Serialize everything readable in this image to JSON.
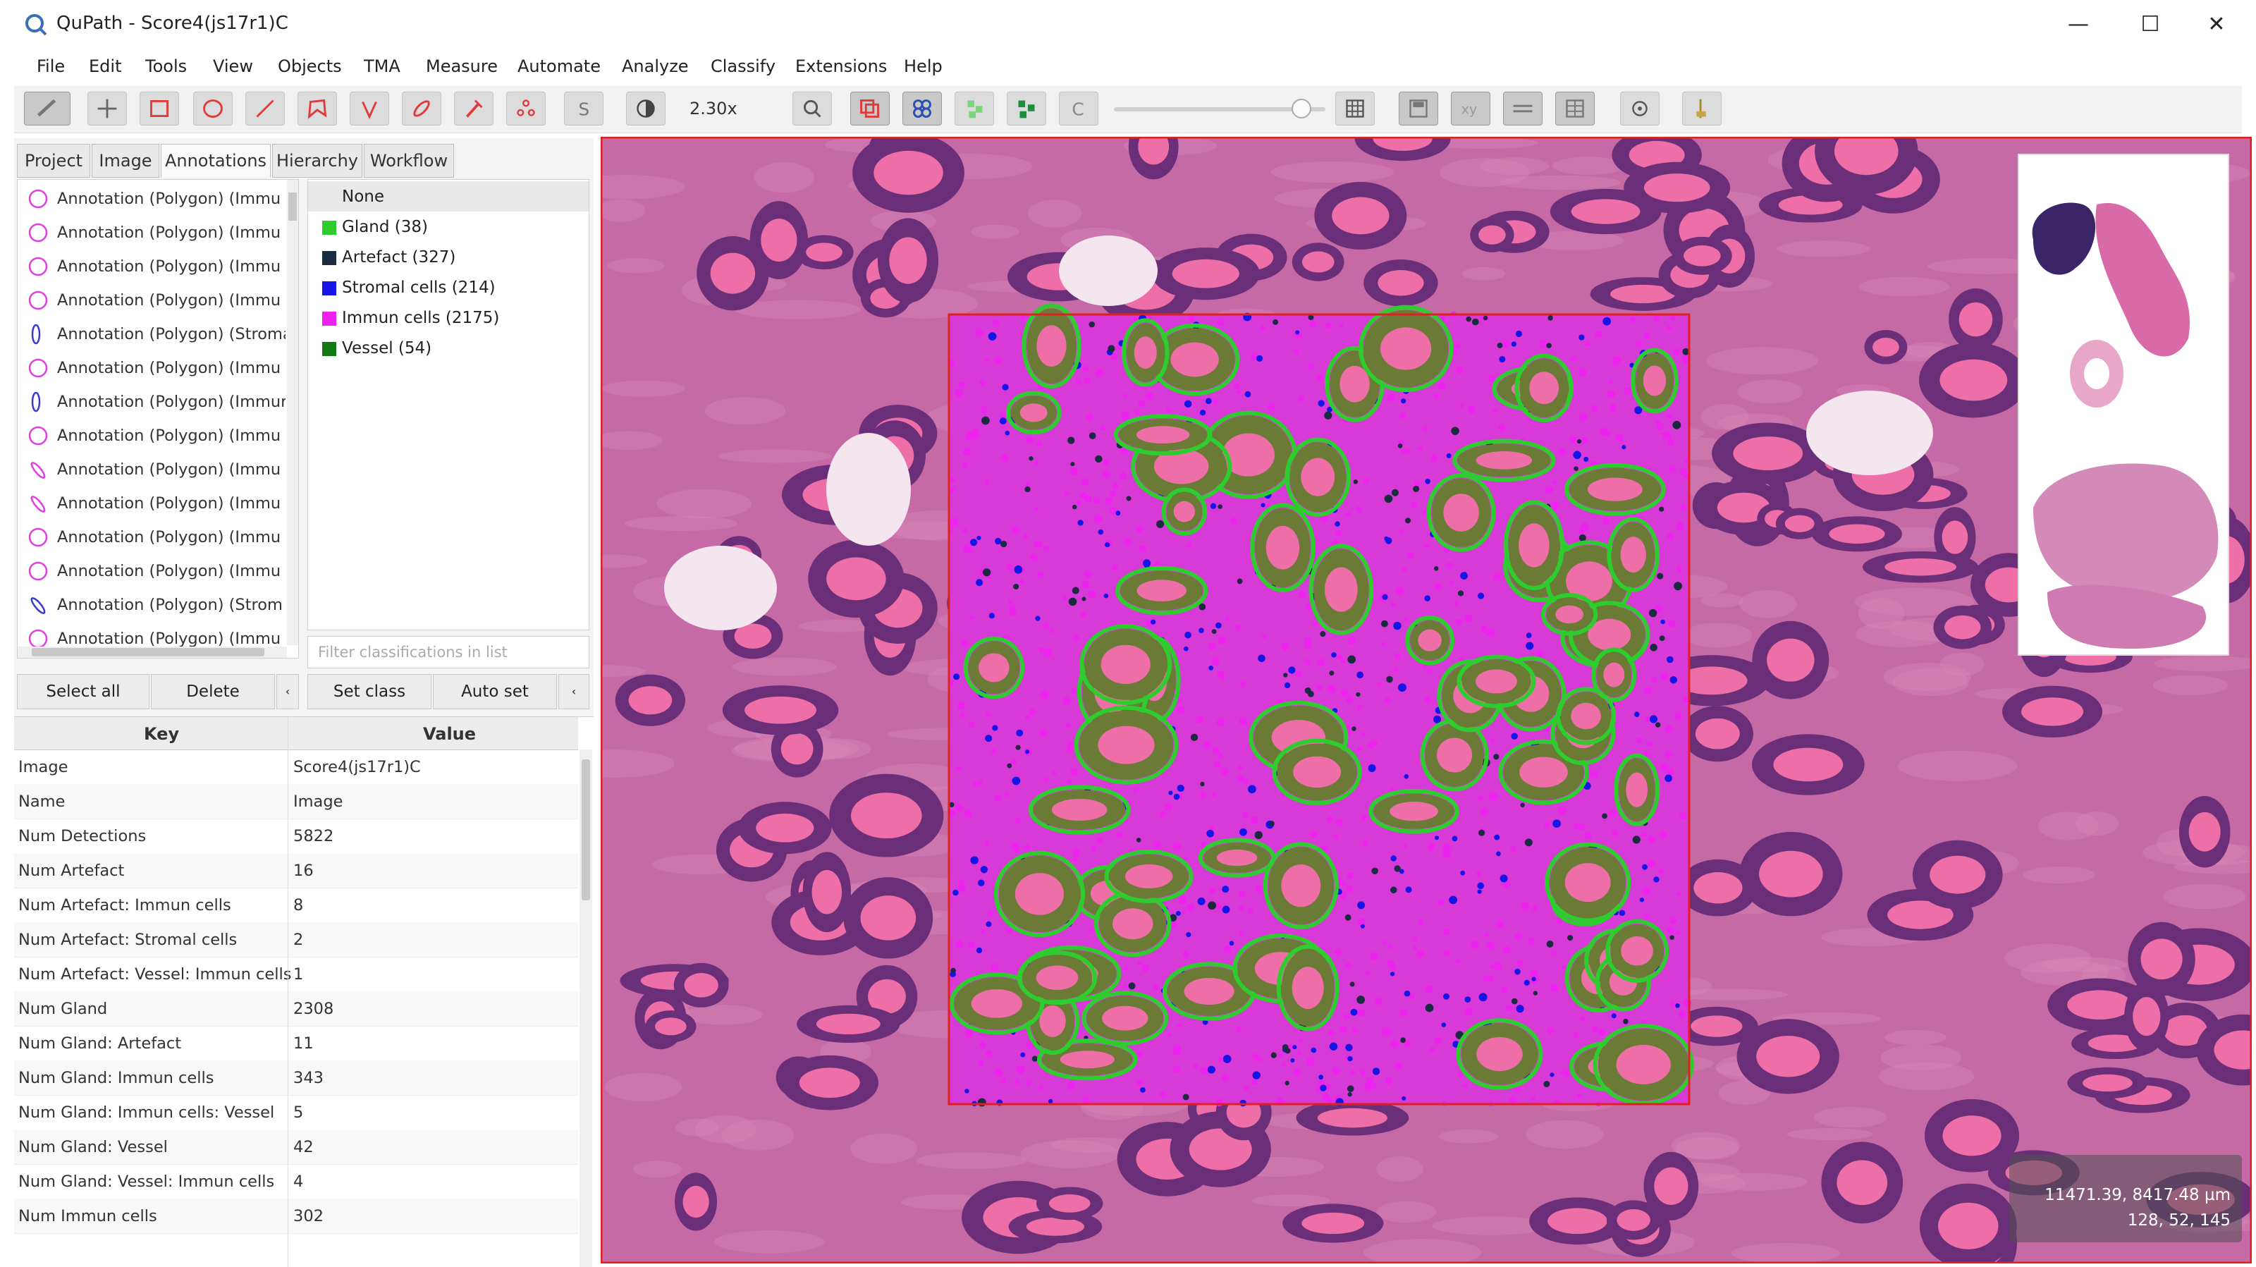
{
  "window": {
    "title": "QuPath - Score4(js17r1)C",
    "controls": {
      "minimize": "—",
      "maximize": "☐",
      "close": "✕"
    }
  },
  "menu": [
    "File",
    "Edit",
    "Tools",
    "View",
    "Objects",
    "TMA",
    "Measure",
    "Automate",
    "Analyze",
    "Classify",
    "Extensions",
    "Help"
  ],
  "toolbar": {
    "zoom_label": "2.30x",
    "tools": [
      "move-tool-icon",
      "rectangle-tool-icon",
      "ellipse-tool-icon",
      "line-tool-icon",
      "polygon-tool-icon",
      "polyline-tool-icon",
      "brush-tool-icon",
      "wand-tool-icon",
      "points-tool-icon"
    ],
    "colors": {
      "red_icon": "#e23a3a",
      "selected_bg": "#c9c9c9"
    }
  },
  "tabs": [
    "Project",
    "Image",
    "Annotations",
    "Hierarchy",
    "Workflow"
  ],
  "active_tab": "Annotations",
  "annotations": [
    {
      "label": "Annotation (Polygon) (Immu",
      "shape": "circle"
    },
    {
      "label": "Annotation (Polygon) (Immu",
      "shape": "circle"
    },
    {
      "label": "Annotation (Polygon) (Immu",
      "shape": "circle"
    },
    {
      "label": "Annotation (Polygon) (Immu",
      "shape": "circle"
    },
    {
      "label": "Annotation (Polygon) (Stroma",
      "shape": "narrow"
    },
    {
      "label": "Annotation (Polygon) (Immu",
      "shape": "circle"
    },
    {
      "label": "Annotation (Polygon) (Immun",
      "shape": "narrow"
    },
    {
      "label": "Annotation (Polygon) (Immu",
      "shape": "circle"
    },
    {
      "label": "Annotation (Polygon) (Immu",
      "shape": "slash"
    },
    {
      "label": "Annotation (Polygon) (Immu",
      "shape": "slash"
    },
    {
      "label": "Annotation (Polygon) (Immu",
      "shape": "circle"
    },
    {
      "label": "Annotation (Polygon) (Immu",
      "shape": "circle"
    },
    {
      "label": "Annotation (Polygon) (Strom",
      "shape": "slash-blue"
    },
    {
      "label": "Annotation (Polygon) (Immu",
      "shape": "circle"
    }
  ],
  "classes": [
    {
      "label": "None",
      "color": ""
    },
    {
      "label": "Gland (38)",
      "color": "#2ecc2e"
    },
    {
      "label": "Artefact (327)",
      "color": "#1a2a40"
    },
    {
      "label": "Stromal cells (214)",
      "color": "#1515e6"
    },
    {
      "label": "Immun cells (2175)",
      "color": "#ee22ee"
    },
    {
      "label": "Vessel (54)",
      "color": "#137a13"
    }
  ],
  "class_filter_placeholder": "Filter classifications in list",
  "buttons": {
    "select_all": "Select all",
    "delete": "Delete",
    "set_class": "Set class",
    "auto_set": "Auto set"
  },
  "properties": {
    "header_key": "Key",
    "header_value": "Value",
    "rows": [
      {
        "k": "Image",
        "v": "Score4(js17r1)C"
      },
      {
        "k": "Name",
        "v": "Image"
      },
      {
        "k": "Num Detections",
        "v": "5822"
      },
      {
        "k": "Num Artefact",
        "v": "16"
      },
      {
        "k": "Num Artefact: Immun cells",
        "v": "8"
      },
      {
        "k": "Num Artefact: Stromal cells",
        "v": "2"
      },
      {
        "k": "Num Artefact: Vessel: Immun cells",
        "v": "1"
      },
      {
        "k": "Num Gland",
        "v": "2308"
      },
      {
        "k": "Num Gland: Artefact",
        "v": "11"
      },
      {
        "k": "Num Gland: Immun cells",
        "v": "343"
      },
      {
        "k": "Num Gland: Immun cells: Vessel",
        "v": "5"
      },
      {
        "k": "Num Gland: Vessel",
        "v": "42"
      },
      {
        "k": "Num Gland: Vessel: Immun cells",
        "v": "4"
      },
      {
        "k": "Num Immun cells",
        "v": "302"
      }
    ]
  },
  "viewer": {
    "coords_line1": "11471.39, 8417.48 µm",
    "coords_line2": "128, 52, 145",
    "colors": {
      "tissue": "#c66aa6",
      "gland_outline": "#2ecc2e",
      "roi": "#e02020",
      "immune": "#ee22ee",
      "stroma": "#1515e6"
    }
  }
}
